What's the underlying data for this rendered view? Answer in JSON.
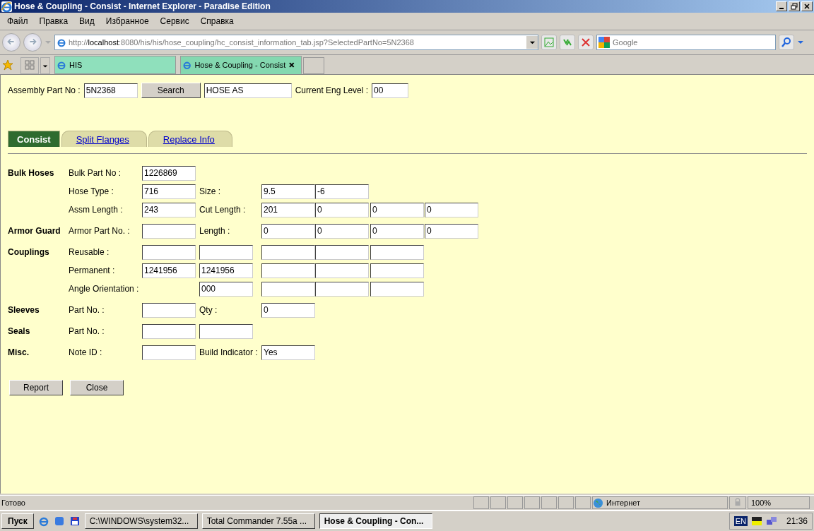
{
  "window": {
    "title": "Hose & Coupling - Consist - Internet Explorer - Paradise Edition"
  },
  "menu": [
    "Файл",
    "Правка",
    "Вид",
    "Избранное",
    "Сервис",
    "Справка"
  ],
  "address": {
    "prefix": "http://",
    "host": "localhost",
    "rest": ":8080/his/his/hose_coupling/hc_consist_information_tab.jsp?SelectedPartNo=5N2368"
  },
  "search": {
    "placeholder": "Google"
  },
  "browser_tabs": [
    {
      "label": "HIS",
      "selected": false
    },
    {
      "label": "Hose & Coupling - Consist",
      "selected": true
    }
  ],
  "header": {
    "part_label": "Assembly Part No :",
    "part_value": "5N2368",
    "search_button": "Search",
    "description": "HOSE AS",
    "level_label": "Current Eng Level :",
    "level_value": "00"
  },
  "tabs": [
    {
      "label": "Consist",
      "selected": true
    },
    {
      "label": "Split Flanges",
      "selected": false
    },
    {
      "label": "Replace Info",
      "selected": false
    }
  ],
  "rows": [
    {
      "section": "Bulk Hoses",
      "cells": [
        {
          "kind": "label",
          "text": "Bulk Part No :"
        },
        {
          "kind": "field",
          "value": "1226869"
        }
      ]
    },
    {
      "cells": [
        {
          "kind": "label",
          "text": "Hose Type :"
        },
        {
          "kind": "field",
          "value": "716"
        },
        {
          "kind": "label",
          "text": "Size :"
        },
        {
          "kind": "field",
          "value": "9.5"
        },
        {
          "kind": "field",
          "value": "-6"
        }
      ]
    },
    {
      "cells": [
        {
          "kind": "label",
          "text": "Assm Length :"
        },
        {
          "kind": "field",
          "value": "243"
        },
        {
          "kind": "label",
          "text": "Cut Length :"
        },
        {
          "kind": "field",
          "value": "201"
        },
        {
          "kind": "field",
          "value": "0"
        },
        {
          "kind": "field",
          "value": "0"
        },
        {
          "kind": "field",
          "value": "0"
        }
      ]
    },
    {
      "section": "Armor Guard",
      "cells": [
        {
          "kind": "label",
          "text": "Armor Part No. :"
        },
        {
          "kind": "field"
        },
        {
          "kind": "label",
          "text": "Length :"
        },
        {
          "kind": "field",
          "value": "0"
        },
        {
          "kind": "field",
          "value": "0"
        },
        {
          "kind": "field",
          "value": "0"
        },
        {
          "kind": "field",
          "value": "0"
        }
      ]
    },
    {
      "section": "Couplings",
      "cells": [
        {
          "kind": "label",
          "text": "Reusable :"
        },
        {
          "kind": "field"
        },
        {
          "kind": "field"
        },
        {
          "kind": "field"
        },
        {
          "kind": "field"
        },
        {
          "kind": "field"
        }
      ]
    },
    {
      "cells": [
        {
          "kind": "label",
          "text": "Permanent :"
        },
        {
          "kind": "field",
          "value": "1241956"
        },
        {
          "kind": "field",
          "value": "1241956"
        },
        {
          "kind": "field"
        },
        {
          "kind": "field"
        },
        {
          "kind": "field"
        }
      ]
    },
    {
      "cells": [
        {
          "kind": "long-label",
          "text": "Angle Orientation :"
        },
        {
          "kind": "field",
          "value": "000"
        },
        {
          "kind": "field"
        },
        {
          "kind": "field"
        },
        {
          "kind": "field"
        }
      ]
    },
    {
      "section": "Sleeves",
      "cells": [
        {
          "kind": "label",
          "text": "Part No. :"
        },
        {
          "kind": "field"
        },
        {
          "kind": "label",
          "text": "Qty :"
        },
        {
          "kind": "field",
          "value": "0"
        }
      ]
    },
    {
      "section": "Seals",
      "cells": [
        {
          "kind": "label",
          "text": "Part No. :"
        },
        {
          "kind": "field"
        },
        {
          "kind": "field"
        }
      ]
    },
    {
      "section": "Misc.",
      "cells": [
        {
          "kind": "label",
          "text": "Note ID :"
        },
        {
          "kind": "field"
        },
        {
          "kind": "label",
          "text": "Build Indicator :"
        },
        {
          "kind": "field",
          "value": "Yes"
        }
      ]
    }
  ],
  "buttons": [
    "Report",
    "Close"
  ],
  "status_bar": {
    "text": "Готово",
    "zone": "Интернет",
    "zoom": "100%"
  },
  "taskbar": {
    "start": "Пуск",
    "windows": [
      {
        "label": "C:\\WINDOWS\\system32...",
        "selected": false
      },
      {
        "label": "Total Commander 7.55a ...",
        "selected": false
      },
      {
        "label": "Hose & Coupling - Con...",
        "selected": true
      }
    ],
    "lang": "EN",
    "clock": "21:36"
  }
}
